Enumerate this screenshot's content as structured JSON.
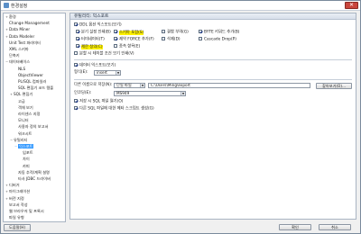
{
  "window": {
    "title": "환경설정",
    "close_glyph": "✕"
  },
  "tree": {
    "items": [
      {
        "label": "환경",
        "twisty": "+",
        "indent": 0,
        "selected": false
      },
      {
        "label": "Change Management",
        "twisty": "",
        "indent": 0,
        "selected": false
      },
      {
        "label": "Data Miner",
        "twisty": "+",
        "indent": 0,
        "selected": false
      },
      {
        "label": "Data Modeler",
        "twisty": "+",
        "indent": 0,
        "selected": false
      },
      {
        "label": "Unit Test 파라미터",
        "twisty": "",
        "indent": 0,
        "selected": false
      },
      {
        "label": "XML 스키마",
        "twisty": "",
        "indent": 0,
        "selected": false
      },
      {
        "label": "단축키",
        "twisty": "",
        "indent": 0,
        "selected": false
      },
      {
        "label": "데이터베이스",
        "twisty": "−",
        "indent": 0,
        "selected": false
      },
      {
        "label": "NLS",
        "twisty": "",
        "indent": 2,
        "selected": false
      },
      {
        "label": "ObjectViewer",
        "twisty": "",
        "indent": 2,
        "selected": false
      },
      {
        "label": "PL/SQL 컴파일러",
        "twisty": "",
        "indent": 2,
        "selected": false
      },
      {
        "label": "SQL 편집기 코드 템플",
        "twisty": "",
        "indent": 2,
        "selected": false
      },
      {
        "label": "SQL 편집기",
        "twisty": "+",
        "indent": 1,
        "selected": false
      },
      {
        "label": "고급",
        "twisty": "",
        "indent": 2,
        "selected": false
      },
      {
        "label": "객체 보기",
        "twisty": "",
        "indent": 2,
        "selected": false
      },
      {
        "label": "라이센스 지정",
        "twisty": "",
        "indent": 2,
        "selected": false
      },
      {
        "label": "모니터",
        "twisty": "",
        "indent": 2,
        "selected": false
      },
      {
        "label": "사용자 정의 보고서",
        "twisty": "",
        "indent": 2,
        "selected": false
      },
      {
        "label": "워크시트",
        "twisty": "",
        "indent": 2,
        "selected": false
      },
      {
        "label": "유틸리티",
        "twisty": "−",
        "indent": 1,
        "selected": false
      },
      {
        "label": "익스포트",
        "twisty": "−",
        "indent": 2,
        "selected": true
      },
      {
        "label": "임포트",
        "twisty": "",
        "indent": 3,
        "selected": false
      },
      {
        "label": "차이",
        "twisty": "",
        "indent": 3,
        "selected": false
      },
      {
        "label": "카피",
        "twisty": "",
        "indent": 3,
        "selected": false
      },
      {
        "label": "자동 추적/계획 설명",
        "twisty": "",
        "indent": 2,
        "selected": false
      },
      {
        "label": "타사 JDBC 드라이버",
        "twisty": "",
        "indent": 2,
        "selected": false
      },
      {
        "label": "디버거",
        "twisty": "+",
        "indent": 0,
        "selected": false
      },
      {
        "label": "마이그레이션",
        "twisty": "+",
        "indent": 0,
        "selected": false
      },
      {
        "label": "버전 지정",
        "twisty": "+",
        "indent": 0,
        "selected": false
      },
      {
        "label": "보고서 작성",
        "twisty": "",
        "indent": 0,
        "selected": false
      },
      {
        "label": "웹 브라우저 및 프록시",
        "twisty": "",
        "indent": 0,
        "selected": false
      },
      {
        "label": "파일 유형",
        "twisty": "",
        "indent": 0,
        "selected": false
      }
    ]
  },
  "panel": {
    "header": "유틸리티: 익스포트",
    "checkboxes": [
      {
        "label": "DDL 옵션 익스포트(보기)",
        "checked": true,
        "highlight": false
      },
      {
        "label": "분기 설정 인쇄(B)",
        "checked": true,
        "highlight": false
      },
      {
        "label": "스키마 포함(S)",
        "checked": true,
        "highlight": true
      },
      {
        "label": "결합 부여(G)",
        "checked": false,
        "highlight": false
      },
      {
        "label": "BYTE 키워드 추가(B)",
        "checked": true,
        "highlight": false
      },
      {
        "label": "터미네이터(T)",
        "checked": true,
        "highlight": false
      },
      {
        "label": "제약 FORCE 추가(F)",
        "checked": true,
        "highlight": false
      },
      {
        "label": "삭제(D)",
        "checked": false,
        "highlight": false
      },
      {
        "label": "Cascade Drop(P)",
        "checked": false,
        "highlight": false
      },
      {
        "label": "제한 정의(C)",
        "checked": true,
        "highlight": true
      },
      {
        "label": "종속 항목(E)",
        "checked": false,
        "highlight": false
      },
      {
        "label": "분할 시 테이블 조건 보기 인쇄(V)",
        "checked": false,
        "highlight": false
      },
      {
        "label": "데이터 익스포트(보기)",
        "checked": true,
        "highlight": false
      }
    ],
    "format_label": "형식(E):",
    "format_value": "insert",
    "save_label": "다른 이름으로 저장(N):",
    "save_option": "단일 파일",
    "path_value": "C:\\Users\\Ming\\export",
    "browse_label": "찾아보기(O)...",
    "encoding_label": "인코딩(E):",
    "encoding_value": "MS949",
    "checks_bottom": [
      {
        "label": "저장 시 SQL 파일 열기(O)",
        "checked": true
      },
      {
        "label": "다른 SQL 파일에 대한 메타 스크립트 생성(G)",
        "checked": true
      }
    ]
  },
  "buttons": {
    "help": "도움말(H)",
    "ok": "확인",
    "cancel": "취소"
  }
}
